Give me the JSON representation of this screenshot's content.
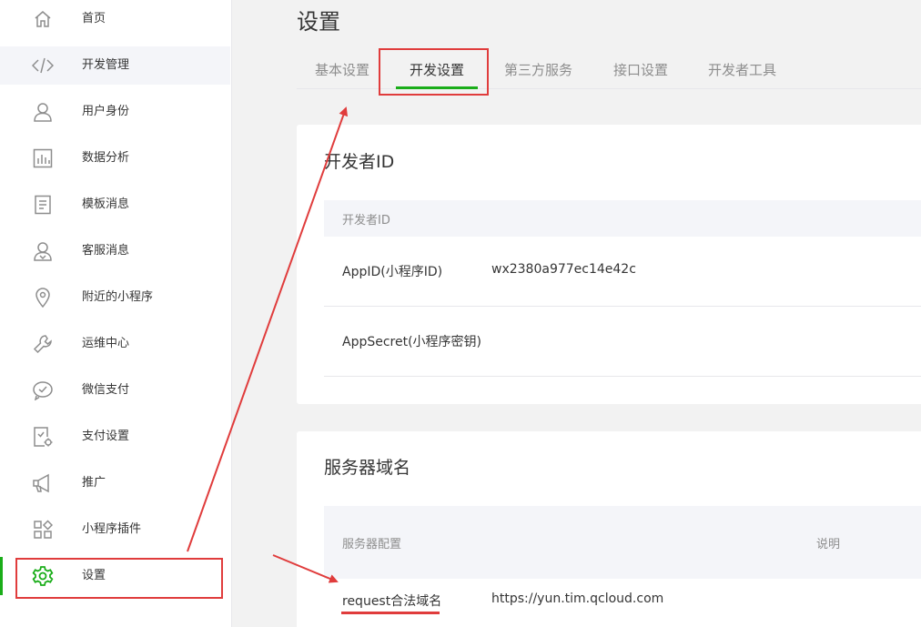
{
  "sidebar": {
    "items": [
      {
        "label": "首页",
        "icon": "home-icon"
      },
      {
        "label": "开发管理",
        "icon": "code-icon"
      },
      {
        "label": "用户身份",
        "icon": "user-icon"
      },
      {
        "label": "数据分析",
        "icon": "chart-icon"
      },
      {
        "label": "模板消息",
        "icon": "document-icon"
      },
      {
        "label": "客服消息",
        "icon": "customer-service-icon"
      },
      {
        "label": "附近的小程序",
        "icon": "location-pin-icon"
      },
      {
        "label": "运维中心",
        "icon": "wrench-icon"
      },
      {
        "label": "微信支付",
        "icon": "wechat-pay-icon"
      },
      {
        "label": "支付设置",
        "icon": "payment-settings-icon"
      },
      {
        "label": "推广",
        "icon": "megaphone-icon"
      },
      {
        "label": "小程序插件",
        "icon": "plugin-grid-icon"
      },
      {
        "label": "设置",
        "icon": "gear-icon"
      }
    ],
    "active_index": 12,
    "hover_index": 1
  },
  "main": {
    "title": "设置",
    "tabs": [
      {
        "label": "基本设置"
      },
      {
        "label": "开发设置"
      },
      {
        "label": "第三方服务"
      },
      {
        "label": "接口设置"
      },
      {
        "label": "开发者工具"
      }
    ],
    "active_tab": 1
  },
  "developer_id_card": {
    "title": "开发者ID",
    "table_header": "开发者ID",
    "rows": [
      {
        "label": "AppID(小程序ID)",
        "value": "wx2380a977ec14e42c"
      },
      {
        "label": "AppSecret(小程序密钥)",
        "value": ""
      }
    ]
  },
  "server_domain_card": {
    "title": "服务器域名",
    "table_header": {
      "col1": "服务器配置",
      "col2": "说明"
    },
    "rows": [
      {
        "label": "request合法域名",
        "value": "https://yun.tim.qcloud.com"
      }
    ]
  },
  "colors": {
    "accent_green": "#1aad19",
    "annotation_red": "#e03c3c"
  }
}
